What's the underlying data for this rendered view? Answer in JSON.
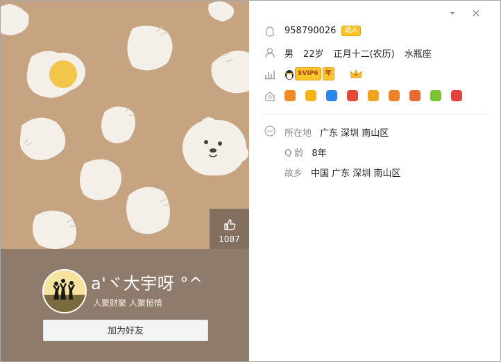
{
  "window": {
    "dropdown_icon": "chevron-down-icon",
    "close_icon": "close-icon",
    "colors": {
      "left_bg": "#c6a482",
      "band": "#8e7b6b",
      "accent_badge": "#f9c52a"
    }
  },
  "cover": {
    "like_count": "1087",
    "like_icon": "thumbs-up-icon"
  },
  "profile": {
    "nickname": "a'ヾ大宇呀 °^",
    "signature": "人聚财聚  人聚恒情",
    "add_friend_label": "加为好友"
  },
  "info": {
    "qq_number": "958790026",
    "qq_tag": "达人",
    "gender": "男",
    "age": "22岁",
    "birthday": "正月十二(农历)",
    "zodiac": "水瓶座",
    "vip_label": "SVIP6",
    "vip_year": "年",
    "services": [
      {
        "name": "qq-show-icon",
        "color": "#f08a24"
      },
      {
        "name": "star-icon",
        "color": "#f5b316"
      },
      {
        "name": "shield-check-icon",
        "color": "#2a86e8"
      },
      {
        "name": "penguin-icon",
        "color": "#e34a3c"
      },
      {
        "name": "music-note-icon",
        "color": "#f0a51e"
      },
      {
        "name": "badge-icon",
        "color": "#e9842a"
      },
      {
        "name": "game-icon",
        "color": "#e86a33"
      },
      {
        "name": "green-music-icon",
        "color": "#7bc235"
      },
      {
        "name": "red-logo-icon",
        "color": "#e0433a"
      }
    ],
    "location_label": "所在地",
    "location_value": "广东  深圳  南山区",
    "qage_label": "Q 龄",
    "qage_value": "8年",
    "hometown_label": "故乡",
    "hometown_value": "中国  广东  深圳  南山区"
  }
}
